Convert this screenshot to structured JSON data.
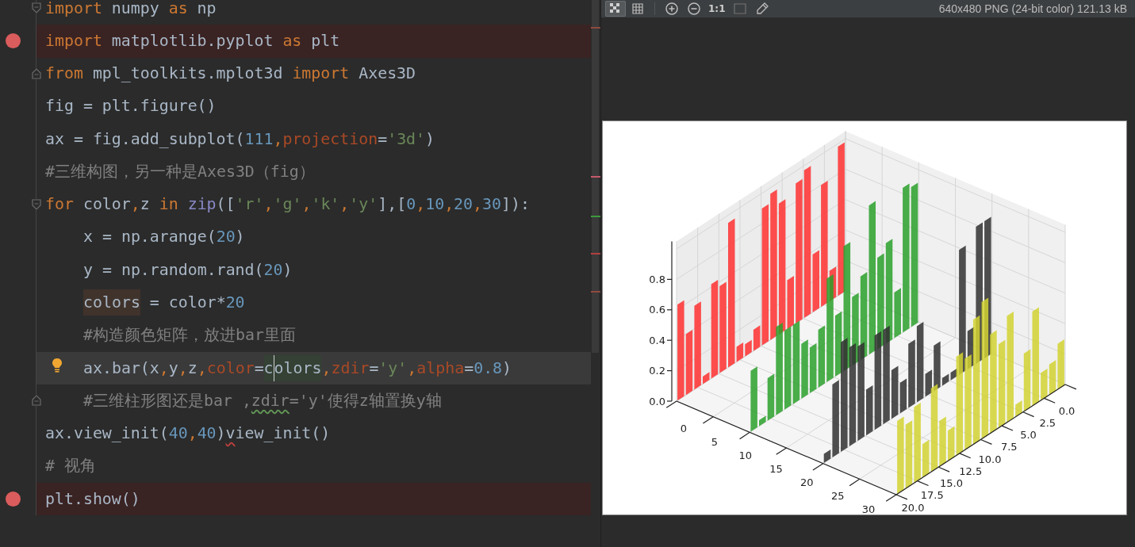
{
  "editor": {
    "lines": [
      {
        "breakpoint": false,
        "bulb": false,
        "fold_open": true,
        "fold_close": false,
        "current": false,
        "tokens": [
          {
            "text": "import",
            "kind": "keyword"
          },
          {
            "text": " numpy ",
            "kind": "plain"
          },
          {
            "text": "as",
            "kind": "keyword"
          },
          {
            "text": " np",
            "kind": "plain"
          }
        ]
      },
      {
        "breakpoint": true,
        "bulb": false,
        "fold_open": false,
        "fold_close": false,
        "current": false,
        "tokens": [
          {
            "text": "import",
            "kind": "keyword"
          },
          {
            "text": " matplotlib.pyplot ",
            "kind": "plain"
          },
          {
            "text": "as",
            "kind": "keyword"
          },
          {
            "text": " plt",
            "kind": "plain"
          }
        ]
      },
      {
        "breakpoint": false,
        "bulb": false,
        "fold_open": false,
        "fold_close": true,
        "current": false,
        "tokens": [
          {
            "text": "from",
            "kind": "keyword"
          },
          {
            "text": " mpl_toolkits.mplot3d ",
            "kind": "plain"
          },
          {
            "text": "import",
            "kind": "keyword"
          },
          {
            "text": " Axes3D",
            "kind": "plain"
          }
        ]
      },
      {
        "breakpoint": false,
        "bulb": false,
        "fold_open": false,
        "fold_close": false,
        "current": false,
        "tokens": [
          {
            "text": "fig = plt.figure()",
            "kind": "plain"
          }
        ]
      },
      {
        "breakpoint": false,
        "bulb": false,
        "fold_open": false,
        "fold_close": false,
        "current": false,
        "tokens": [
          {
            "text": "ax = fig.add_subplot(",
            "kind": "plain"
          },
          {
            "text": "111",
            "kind": "number"
          },
          {
            "text": ",",
            "kind": "comma"
          },
          {
            "text": "projection",
            "kind": "param"
          },
          {
            "text": "=",
            "kind": "plain"
          },
          {
            "text": "'3d'",
            "kind": "string"
          },
          {
            "text": ")",
            "kind": "plain"
          }
        ]
      },
      {
        "breakpoint": false,
        "bulb": false,
        "fold_open": false,
        "fold_close": false,
        "current": false,
        "tokens": [
          {
            "text": "#三维构图，另一种是Axes3D（fig）",
            "kind": "comment"
          }
        ]
      },
      {
        "breakpoint": false,
        "bulb": false,
        "fold_open": true,
        "fold_close": false,
        "current": false,
        "tokens": [
          {
            "text": "for",
            "kind": "keyword"
          },
          {
            "text": " color",
            "kind": "plain"
          },
          {
            "text": ",",
            "kind": "comma"
          },
          {
            "text": "z ",
            "kind": "plain"
          },
          {
            "text": "in ",
            "kind": "keyword"
          },
          {
            "text": "zip",
            "kind": "builtin"
          },
          {
            "text": "([",
            "kind": "plain"
          },
          {
            "text": "'r'",
            "kind": "string"
          },
          {
            "text": ",",
            "kind": "comma"
          },
          {
            "text": "'g'",
            "kind": "string"
          },
          {
            "text": ",",
            "kind": "comma"
          },
          {
            "text": "'k'",
            "kind": "string"
          },
          {
            "text": ",",
            "kind": "comma"
          },
          {
            "text": "'y'",
            "kind": "string"
          },
          {
            "text": "],[",
            "kind": "plain"
          },
          {
            "text": "0",
            "kind": "number"
          },
          {
            "text": ",",
            "kind": "comma"
          },
          {
            "text": "10",
            "kind": "number"
          },
          {
            "text": ",",
            "kind": "comma"
          },
          {
            "text": "20",
            "kind": "number"
          },
          {
            "text": ",",
            "kind": "comma"
          },
          {
            "text": "30",
            "kind": "number"
          },
          {
            "text": "]):",
            "kind": "plain"
          }
        ],
        "children": [
          {
            "breakpoint": false,
            "bulb": false,
            "fold_open": false,
            "fold_close": false,
            "current": false,
            "tokens": [
              {
                "text": "x = np.arange(",
                "kind": "plain"
              },
              {
                "text": "20",
                "kind": "number"
              },
              {
                "text": ")",
                "kind": "plain"
              }
            ]
          },
          {
            "breakpoint": false,
            "bulb": false,
            "fold_open": false,
            "fold_close": false,
            "current": false,
            "tokens": [
              {
                "text": "y = np.random.rand(",
                "kind": "plain"
              },
              {
                "text": "20",
                "kind": "number"
              },
              {
                "text": ")",
                "kind": "plain"
              }
            ]
          },
          {
            "breakpoint": false,
            "bulb": false,
            "fold_open": false,
            "fold_close": false,
            "current": false,
            "tokens": [
              {
                "text": "colors",
                "kind": "read_usage"
              },
              {
                "text": " = color*",
                "kind": "plain"
              },
              {
                "text": "20",
                "kind": "number"
              }
            ]
          },
          {
            "breakpoint": false,
            "bulb": false,
            "fold_open": false,
            "fold_close": false,
            "current": false,
            "tokens": [
              {
                "text": "#构造颜色矩阵，放进bar里面",
                "kind": "comment"
              }
            ]
          },
          {
            "breakpoint": false,
            "bulb": true,
            "fold_open": false,
            "fold_close": false,
            "current": true,
            "tokens": [
              {
                "text": "ax.bar(x",
                "kind": "plain"
              },
              {
                "text": ",",
                "kind": "comma"
              },
              {
                "text": "y",
                "kind": "plain"
              },
              {
                "text": ",",
                "kind": "comma"
              },
              {
                "text": "z",
                "kind": "plain"
              },
              {
                "text": ",",
                "kind": "comma"
              },
              {
                "text": "color",
                "kind": "param"
              },
              {
                "text": "=",
                "kind": "plain"
              },
              {
                "text": "c",
                "kind": "usage"
              },
              {
                "text": "olors",
                "kind": "usage_caret"
              },
              {
                "text": ",",
                "kind": "comma"
              },
              {
                "text": "zdir",
                "kind": "param"
              },
              {
                "text": "=",
                "kind": "plain"
              },
              {
                "text": "'y'",
                "kind": "string"
              },
              {
                "text": ",",
                "kind": "comma"
              },
              {
                "text": "alpha",
                "kind": "param"
              },
              {
                "text": "=",
                "kind": "plain"
              },
              {
                "text": "0.8",
                "kind": "number"
              },
              {
                "text": ")",
                "kind": "plain"
              }
            ]
          },
          {
            "breakpoint": false,
            "bulb": false,
            "fold_open": false,
            "fold_close": true,
            "current": false,
            "tokens": [
              {
                "text": "#三维柱形图还是bar ,",
                "kind": "comment"
              },
              {
                "text": "zdir",
                "kind": "comment_typo"
              },
              {
                "text": "='y'使得z轴置换y轴",
                "kind": "comment"
              }
            ]
          }
        ]
      },
      {
        "breakpoint": false,
        "bulb": false,
        "fold_open": false,
        "fold_close": false,
        "current": false,
        "tokens": [
          {
            "text": "ax.view_init(",
            "kind": "plain"
          },
          {
            "text": "40",
            "kind": "number"
          },
          {
            "text": ",",
            "kind": "comma"
          },
          {
            "text": "40",
            "kind": "number"
          },
          {
            "text": ")",
            "kind": "plain"
          },
          {
            "text": "v",
            "kind": "error"
          },
          {
            "text": "iew_init()",
            "kind": "plain"
          }
        ]
      },
      {
        "breakpoint": false,
        "bulb": false,
        "fold_open": false,
        "fold_close": false,
        "current": false,
        "tokens": [
          {
            "text": "# 视角",
            "kind": "comment"
          }
        ]
      },
      {
        "breakpoint": true,
        "bulb": false,
        "fold_open": false,
        "fold_close": false,
        "current": false,
        "tokens": [
          {
            "text": "plt.show()",
            "kind": "plain"
          }
        ]
      }
    ]
  },
  "viewer": {
    "toolbar": [
      {
        "kind": "checker",
        "selected": true,
        "disabled": false
      },
      {
        "kind": "grid",
        "selected": false,
        "disabled": false
      },
      {
        "kind": "zoom_in",
        "selected": false,
        "disabled": false
      },
      {
        "kind": "zoom_out",
        "selected": false,
        "disabled": false
      },
      {
        "kind": "actual_size",
        "label": "1:1",
        "selected": false,
        "disabled": false
      },
      {
        "kind": "fit",
        "selected": false,
        "disabled": true
      },
      {
        "kind": "eyedropper",
        "selected": false,
        "disabled": false
      }
    ],
    "info": "640x480 PNG (24-bit color) 121.13 kB",
    "plot": {
      "z_ticks": [
        "0.8",
        "0.6",
        "0.4",
        "0.2",
        "0.0"
      ],
      "x_ticks": [
        "0",
        "5",
        "10",
        "15",
        "20",
        "25",
        "30"
      ],
      "y_ticks": [
        "0.0",
        "2.5",
        "5.0",
        "7.5",
        "10.0",
        "12.5",
        "15.0",
        "17.5",
        "20.0"
      ]
    }
  }
}
